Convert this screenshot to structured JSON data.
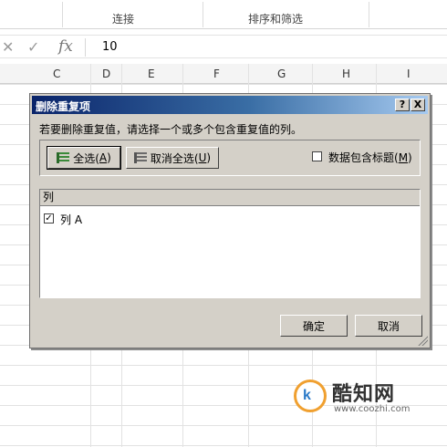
{
  "ribbon": {
    "groups": [
      "连接",
      "排序和筛选"
    ]
  },
  "formula_bar": {
    "function_label": "fx",
    "cell_value": "10"
  },
  "grid": {
    "columns": [
      "C",
      "D",
      "E",
      "F",
      "G",
      "H",
      "I"
    ]
  },
  "dialog": {
    "title": "删除重复项",
    "help_label": "?",
    "close_label": "X",
    "instruction": "若要删除重复值，请选择一个或多个包含重复值的列。",
    "select_all": {
      "text": "全选(",
      "key": "A",
      "end": ")"
    },
    "deselect_all": {
      "text": "取消全选(",
      "key": "U",
      "end": ")"
    },
    "header_checkbox": {
      "text": "数据包含标题(",
      "key": "M",
      "end": ")",
      "checked": false
    },
    "list_header": "列",
    "columns": [
      {
        "label": "列 A",
        "checked": true
      }
    ],
    "ok_label": "确定",
    "cancel_label": "取消"
  },
  "watermark": {
    "logo_text": "k",
    "name": "酷知网",
    "url": "www.coozhi.com"
  },
  "colors": {
    "dialog_face": "#d4d0c8",
    "title_start": "#0a246a",
    "title_end": "#a6caf0",
    "watermark_ring": "#f0a030"
  }
}
